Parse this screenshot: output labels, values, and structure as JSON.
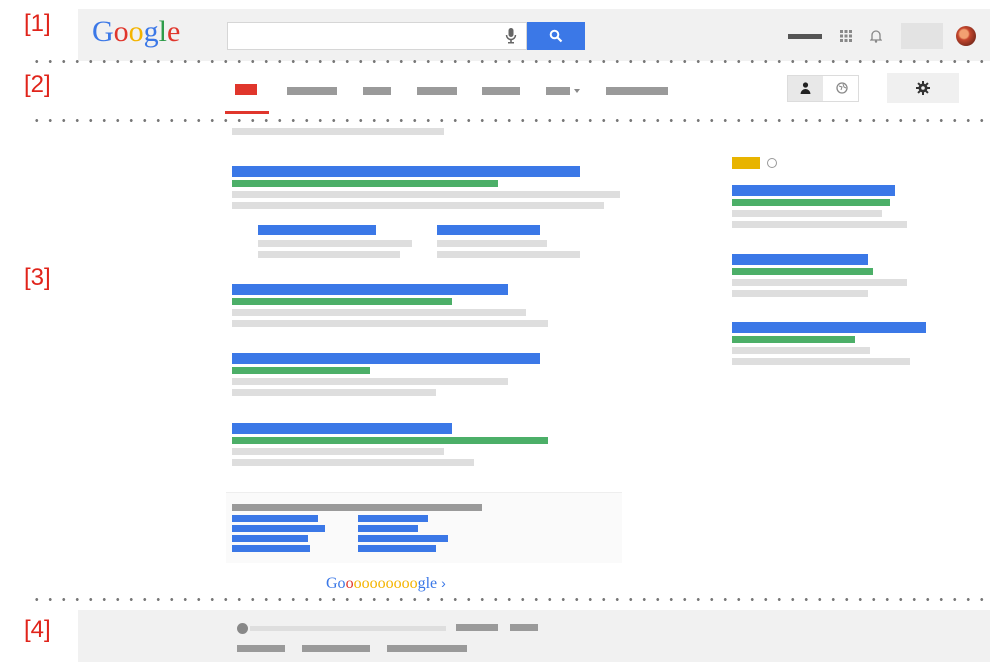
{
  "section_labels": [
    "[1]",
    "[2]",
    "[3]",
    "[4]"
  ],
  "header": {
    "logo_letters": [
      "G",
      "o",
      "o",
      "g",
      "l",
      "e"
    ],
    "logo_colors": [
      "#3b78e7",
      "#e0362c",
      "#f4b400",
      "#3b78e7",
      "#2e9c4a",
      "#e0362c"
    ],
    "search_value": "",
    "mic_icon": "microphone-icon",
    "search_icon": "magnifier-icon",
    "apps_icon": "grid-icon",
    "notifications_icon": "bell-icon"
  },
  "pagination": {
    "pre": "Go",
    "letters": [
      "o",
      "o",
      "o",
      "o",
      "o",
      "o",
      "o",
      "o",
      "o"
    ],
    "post": "gle",
    "arrow": "›"
  },
  "colors": {
    "accent_blue": "#3b78e7",
    "url_green": "#4caf68",
    "active_tab_red": "#e0362c",
    "ad_badge_yellow": "#e8b400",
    "label_red": "#e0241b"
  }
}
